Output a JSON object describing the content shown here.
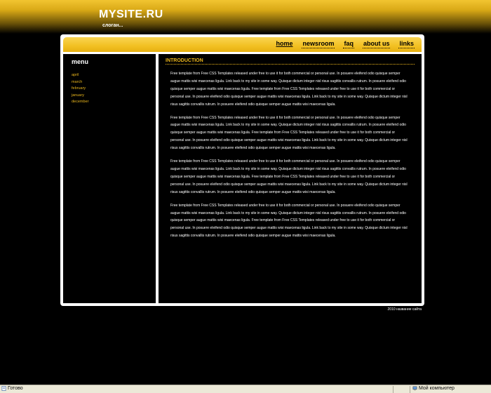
{
  "header": {
    "site_title": "MYSITE.RU",
    "slogan": "слоган..."
  },
  "nav": {
    "items": [
      {
        "label": "home"
      },
      {
        "label": "newsroom"
      },
      {
        "label": "faq"
      },
      {
        "label": "about us"
      },
      {
        "label": "links"
      }
    ]
  },
  "sidebar": {
    "title": "menu",
    "items": [
      {
        "label": "april"
      },
      {
        "label": "march"
      },
      {
        "label": "february"
      },
      {
        "label": "january"
      },
      {
        "label": "december"
      }
    ]
  },
  "content": {
    "title": "INTRODUCTION",
    "paragraphs": [
      "Free template from Free CSS Templates released under free to use it for both commercial or personal use. In posuere eleifend odio quisque semper augue mattis wisi maecenas ligula. Link back to my site in some way. Quisque dictum integer nisl risus sagittis convallis rutrum. In posuere eleifend odio quisque semper augue mattis wisi maecenas ligula. Free template from Free CSS Templates released under free to use it for both commercial or personal use. In posuere eleifend odio quisque semper augue mattis wisi maecenas ligula. Link back to my site in some way. Quisque dictum integer nisl risus sagittis convallis rutrum. In posuere eleifend odio quisque semper augue mattis wisi maecenas ligula.",
      "Free template from Free CSS Templates released under free to use it for both commercial or personal use. In posuere eleifend odio quisque semper augue mattis wisi maecenas ligula. Link back to my site in some way. Quisque dictum integer nisl risus sagittis convallis rutrum. In posuere eleifend odio quisque semper augue mattis wisi maecenas ligula. Free template from Free CSS Templates released under free to use it for both commercial or personal use. In posuere eleifend odio quisque semper augue mattis wisi maecenas ligula. Link back to my site in some way. Quisque dictum integer nisl risus sagittis convallis rutrum. In posuere eleifend odio quisque semper augue mattis wisi maecenas ligula.",
      "Free template from Free CSS Templates released under free to use it for both commercial or personal use. In posuere eleifend odio quisque semper augue mattis wisi maecenas ligula. Link back to my site in some way. Quisque dictum integer nisl risus sagittis convallis rutrum. In posuere eleifend odio quisque semper augue mattis wisi maecenas ligula. Free template from Free CSS Templates released under free to use it for both commercial or personal use. In posuere eleifend odio quisque semper augue mattis wisi maecenas ligula. Link back to my site in some way. Quisque dictum integer nisl risus sagittis convallis rutrum. In posuere eleifend odio quisque semper augue mattis wisi maecenas ligula.",
      "Free template from Free CSS Templates released under free to use it for both commercial or personal use. In posuere eleifend odio quisque semper augue mattis wisi maecenas ligula. Link back to my site in some way. Quisque dictum integer nisl risus sagittis convallis rutrum. In posuere eleifend odio quisque semper augue mattis wisi maecenas ligula. Free template from Free CSS Templates released under free to use it for both commercial or personal use. In posuere eleifend odio quisque semper augue mattis wisi maecenas ligula. Link back to my site in some way. Quisque dictum integer nisl risus sagittis convallis rutrum. In posuere eleifend odio quisque semper augue mattis wisi maecenas ligula."
    ]
  },
  "footer": {
    "copyright": "2010 название сайта"
  },
  "status_bar": {
    "left_text": "Готово",
    "right_text": "Мой компьютер",
    "left_icon": "page-icon",
    "right_icon": "computer-icon"
  },
  "colors": {
    "accent": "#f0b91c",
    "nav_bar": "#f2c022",
    "background": "#000000",
    "frame": "#ffffff"
  }
}
